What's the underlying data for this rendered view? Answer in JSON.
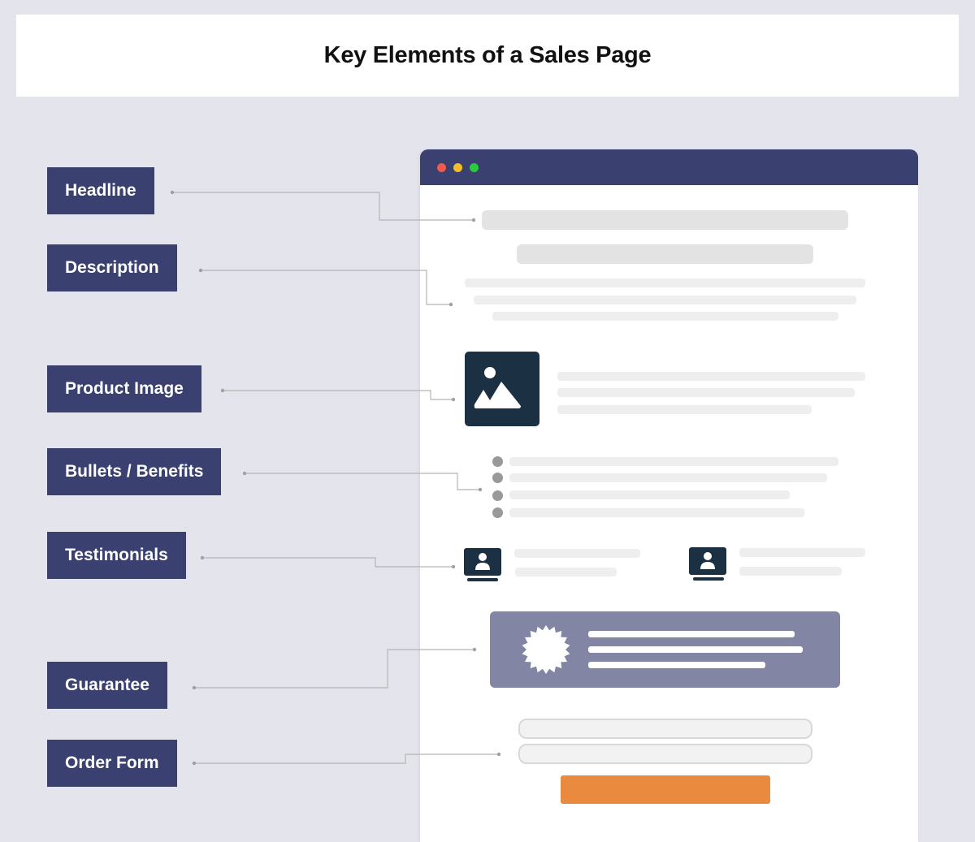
{
  "title": "Key Elements of a Sales Page",
  "labels": [
    {
      "id": "headline",
      "text": "Headline"
    },
    {
      "id": "description",
      "text": "Description"
    },
    {
      "id": "product-image",
      "text": "Product Image"
    },
    {
      "id": "bullets-benefits",
      "text": "Bullets / Benefits"
    },
    {
      "id": "testimonials",
      "text": "Testimonials"
    },
    {
      "id": "guarantee",
      "text": "Guarantee"
    },
    {
      "id": "order-form",
      "text": "Order Form"
    }
  ],
  "browser": {
    "window_controls": [
      "close",
      "minimize",
      "maximize"
    ],
    "control_colors": {
      "close": "#f05a4f",
      "minimize": "#f7bb2c",
      "maximize": "#2ac940"
    },
    "frame_color": "#3a4170"
  },
  "colors": {
    "background": "#e4e4ed",
    "label_bg": "#3a4170",
    "image_icon_bg": "#1c3044",
    "guarantee_bg": "#8285a3",
    "cta_button": "#e98a3e",
    "connector": "#b0b0b0"
  },
  "bullets_count": 4,
  "testimonials_count": 2,
  "order_form_fields_count": 2
}
